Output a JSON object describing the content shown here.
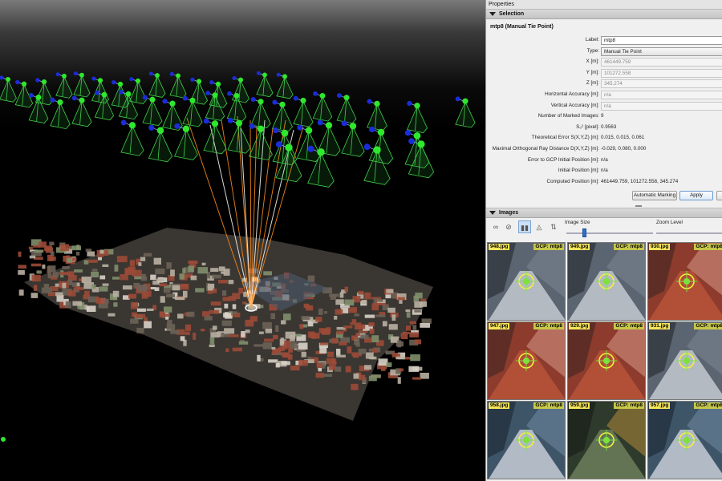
{
  "panel": {
    "title": "Properties",
    "selection_header": "Selection",
    "selection_title": "mtp8 (Manual Tie Point)",
    "fields": [
      {
        "label": "Label:",
        "value": "mtp8",
        "kind": "input"
      },
      {
        "label": "Type:",
        "value": "Manual Tie Point",
        "kind": "combo"
      },
      {
        "label": "X [m]:",
        "value": "461449.759",
        "kind": "readonly"
      },
      {
        "label": "Y [m]:",
        "value": "101272.558",
        "kind": "readonly"
      },
      {
        "label": "Z [m]:",
        "value": "345.274",
        "kind": "readonly"
      },
      {
        "label": "Horizontal Accuracy [m]:",
        "value": "n/a",
        "kind": "readonly"
      },
      {
        "label": "Vertical Accuracy [m]:",
        "value": "n/a",
        "kind": "readonly"
      },
      {
        "label": "Number of Marked Images:",
        "value": "9",
        "kind": "text"
      },
      {
        "label": "S₀² [pixel]:",
        "value": "0.9563",
        "kind": "text"
      },
      {
        "label": "Theoretical Error S(X,Y,Z) [m]:",
        "value": "0.015, 0.015, 0.061",
        "kind": "text"
      },
      {
        "label": "Maximal Orthogonal Ray Distance D(X,Y,Z) [m]:",
        "value": "-0.029, 0.080, 0.000",
        "kind": "text"
      },
      {
        "label": "Error to GCP Initial Position [m]:",
        "value": "n/a",
        "kind": "text"
      },
      {
        "label": "Initial Position [m]:",
        "value": "n/a",
        "kind": "text"
      },
      {
        "label": "Computed Position [m]:",
        "value": "461449.759, 101272.558, 345.274",
        "kind": "text"
      }
    ],
    "automatic_marking_label": "Automatic Marking",
    "apply_label": "Apply",
    "images_header": "Images",
    "image_size_label": "Image Size",
    "zoom_level_label": "Zoom Level",
    "image_size_value": 0.2
  },
  "thumbnails": [
    {
      "file": "948.jpg",
      "gcp": "GCP: mtp8",
      "scene": "roof-grey"
    },
    {
      "file": "949.jpg",
      "gcp": "GCP: mtp8",
      "scene": "roof-grey"
    },
    {
      "file": "930.jpg",
      "gcp": "GCP: mtp8",
      "scene": "roof-red"
    },
    {
      "file": "947.jpg",
      "gcp": "GCP: mtp8",
      "scene": "roof-red"
    },
    {
      "file": "929.jpg",
      "gcp": "GCP: mtp8",
      "scene": "roof-red"
    },
    {
      "file": "931.jpg",
      "gcp": "GCP: mtp8",
      "scene": "roof-grey"
    },
    {
      "file": "958.jpg",
      "gcp": "GCP: mtp8",
      "scene": "roof-blue"
    },
    {
      "file": "959.jpg",
      "gcp": "GCP: mtp8",
      "scene": "roof-dark"
    },
    {
      "file": "957.jpg",
      "gcp": "GCP: mtp8",
      "scene": "roof-blue"
    }
  ],
  "colors": {
    "camera_frustum": "#3fd14a",
    "camera_center": "#2ee82e",
    "camera_direction": "#1c2cd8",
    "ray": "#ff8c1a",
    "ray_highlight": "#ffffff",
    "marker": "#f2f23a"
  }
}
